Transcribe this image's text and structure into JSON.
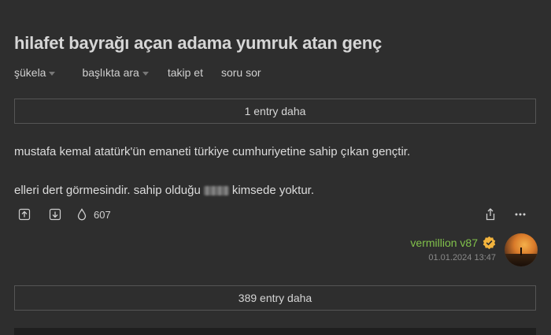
{
  "topic": {
    "title": "hilafet bayrağı açan adama yumruk atan genç"
  },
  "subnav": {
    "items": [
      {
        "label": "şükela",
        "dropdown": true
      },
      {
        "label": "başlıkta ara",
        "dropdown": true
      },
      {
        "label": "takip et",
        "dropdown": false
      },
      {
        "label": "soru sor",
        "dropdown": false
      }
    ]
  },
  "more_before": {
    "label": "1 entry daha"
  },
  "entry": {
    "paragraph1": "mustafa kemal atatürk'ün emaneti türkiye cumhuriyetine sahip çıkan gençtir.",
    "paragraph2_before": "elleri dert görmesindir. sahip olduğu",
    "paragraph2_after": "kimsede yoktur.",
    "favorite_count": "607",
    "icons": {
      "upvote": "upvote-icon",
      "downvote": "downvote-icon",
      "favorite": "drop-icon",
      "share": "share-icon",
      "more": "more-icon"
    }
  },
  "author": {
    "name": "vermillion v87",
    "date": "01.01.2024 13:47",
    "verified": true,
    "badge_color": "#f2b33d",
    "name_color": "#81c14b"
  },
  "more_after": {
    "label": "389 entry daha"
  }
}
